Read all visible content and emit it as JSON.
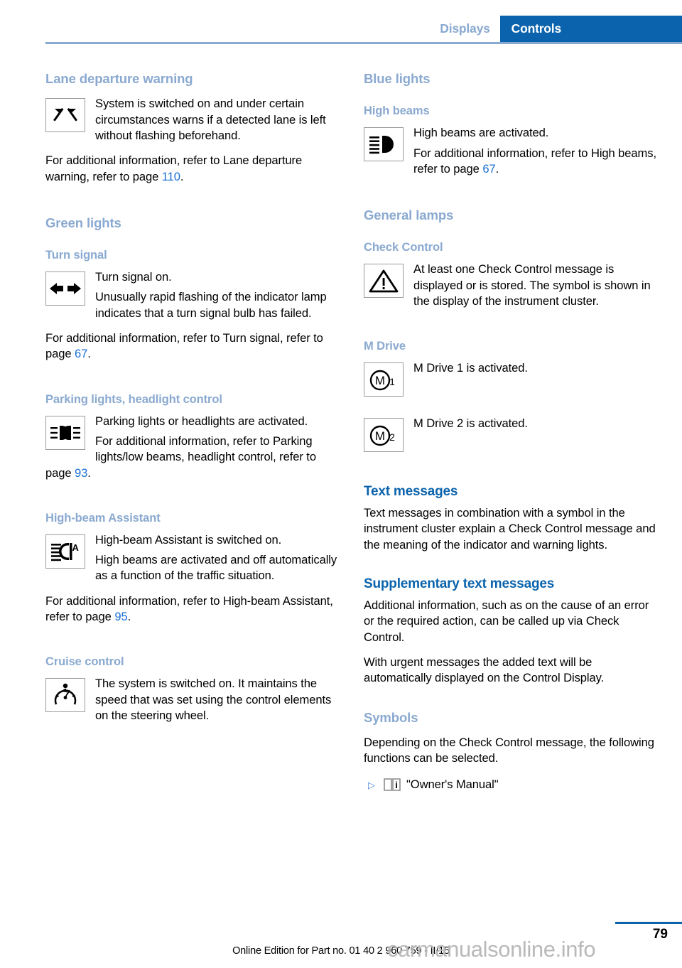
{
  "header": {
    "tab_inactive": "Displays",
    "tab_active": "Controls",
    "accent_blue": "#0a63ac",
    "light_blue": "#8aa9d0"
  },
  "left_column": {
    "lane_departure": {
      "heading": "Lane departure warning",
      "icon": "lane-departure-warning-icon",
      "icon_text": "System is switched on and under certain circumstances warns if a detected lane is left without flashing beforehand.",
      "para_prefix": "For additional information, refer to Lane departure warning, refer to page ",
      "page": "110",
      "para_suffix": "."
    },
    "green_lights_heading": "Green lights",
    "turn_signal": {
      "heading": "Turn signal",
      "icon": "turn-signal-arrows-icon",
      "line1": "Turn signal on.",
      "line2": "Unusually rapid flashing of the indicator lamp indicates that a turn signal bulb has failed.",
      "para_prefix": "For additional information, refer to Turn signal, refer to page ",
      "page": "67",
      "para_suffix": "."
    },
    "parking_lights": {
      "heading": "Parking lights, headlight control",
      "icon": "parking-lights-icon",
      "line1": "Parking lights or headlights are activated.",
      "para_prefix": "For additional information, refer to Parking lights/low beams, headlight control, refer to page ",
      "page": "93",
      "para_suffix": "."
    },
    "high_beam_assistant": {
      "heading": "High-beam Assistant",
      "icon": "high-beam-assistant-icon",
      "line1": "High-beam Assistant is switched on.",
      "line2": "High beams are activated and off automatically as a function of the traffic situation.",
      "para_prefix": "For additional information, refer to High-beam Assistant, refer to page ",
      "page": "95",
      "para_suffix": "."
    },
    "cruise_control": {
      "heading": "Cruise control",
      "icon": "cruise-control-speedometer-icon",
      "line1": "The system is switched on. It maintains the speed that was set using the control elements on the steering wheel."
    }
  },
  "right_column": {
    "blue_lights_heading": "Blue lights",
    "high_beams": {
      "heading": "High beams",
      "icon": "high-beam-icon",
      "line1": "High beams are activated.",
      "para_prefix": "For additional information, refer to High beams, refer to page ",
      "page": "67",
      "para_suffix": "."
    },
    "general_lamps_heading": "General lamps",
    "check_control": {
      "heading": "Check Control",
      "icon": "warning-triangle-icon",
      "line1": "At least one Check Control message is displayed or is stored. The symbol is shown in the display of the instrument cluster."
    },
    "m_drive": {
      "heading": "M Drive",
      "icon1": "m-drive-1-icon",
      "label1": "M Drive 1 is activated.",
      "icon2": "m-drive-2-icon",
      "label2": "M Drive 2 is activated."
    },
    "text_messages": {
      "heading": "Text messages",
      "body": "Text messages in combination with a symbol in the instrument cluster explain a Check Control message and the meaning of the indicator and warning lights."
    },
    "supplementary": {
      "heading": "Supplementary text messages",
      "body1": "Additional information, such as on the cause of an error or the required action, can be called up via Check Control.",
      "body2": "With urgent messages the added text will be automatically displayed on the Control Display."
    },
    "symbols": {
      "heading": "Symbols",
      "body": "Depending on the Check Control message, the following functions can be selected.",
      "bullet_marker": "triangle-bullet-icon",
      "bullet_icon": "owners-manual-book-icon",
      "bullet_label": "\"Owner's Manual\""
    }
  },
  "footer": {
    "page_number": "79",
    "edition_text": "Online Edition for Part no. 01 40 2 960 759 - II/15",
    "watermark": "carmanualsonline.info"
  }
}
